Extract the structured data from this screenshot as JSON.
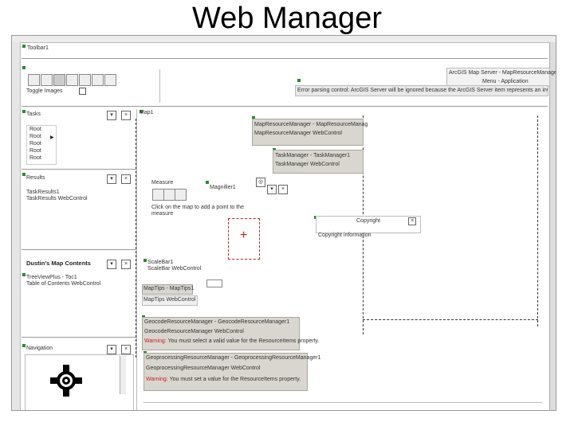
{
  "slide_title": "Web Manager",
  "toolbar": {
    "label": "Toolbar1"
  },
  "toggle_images_label": "Toggle Images",
  "map_res_panel": {
    "line1": "MapResourceManager - MapResourceManag",
    "line2": "MapResourceManager WebControl"
  },
  "map_top_right": {
    "line1": "ArcGIS Map Server - MapResourceManager1",
    "line2": "Menu - Application"
  },
  "warning_banner": "Error parsing control: ArcGIS Server will be ignored because the ArcGIS Server item represents an invalid URL.",
  "map_control_label": "Map1",
  "tasks_label": "Tasks",
  "tasks_items": [
    "Root",
    "Root",
    "Root",
    "Root",
    "Root"
  ],
  "results_label": "Results",
  "results_lines": [
    "TaskResults1",
    "TaskResults WebControl"
  ],
  "toc_label": "Dustin's Map Contents",
  "toc_lines": [
    "TreeViewPlus - Toc1",
    "Table of Contents WebControl"
  ],
  "navigation_label": "Navigation",
  "task_manager": {
    "line1": "TaskManager - TaskManager1",
    "line2": "TaskManager WebControl"
  },
  "measure": {
    "label": "Measure",
    "line1": "Click on the map to add a point to the",
    "line2": "measure"
  },
  "magnifier_label": "Magnifier1",
  "copyright": {
    "label": "Copyright",
    "text": "Copyright information"
  },
  "scalebar": {
    "line1": "ScaleBar1",
    "line2": "ScaleBar WebControl"
  },
  "map_tips": {
    "line1": "MapTips - MapTips1",
    "line2": "MapTips WebControl"
  },
  "geocode": {
    "title": "GeocodeResourceManager - GeocodeResourceManager1",
    "line1": "GeocodeResourceManager WebControl",
    "warn_word": "Warning:",
    "warn_text": "You must select a valid value for the ResourceItems property."
  },
  "geoprocessing": {
    "title": "GeoprocessingResourceManager - GeoprocessingResourceManager1",
    "line1": "GeoprocessingResourceManager WebControl",
    "warn_word": "Warning:",
    "warn_text": "You must set a value for the ResourceItems property."
  },
  "colors": {
    "accent_red": "#c81e1e",
    "marker_green": "#2c8a2c",
    "panel_gray": "#d9d6cf"
  }
}
